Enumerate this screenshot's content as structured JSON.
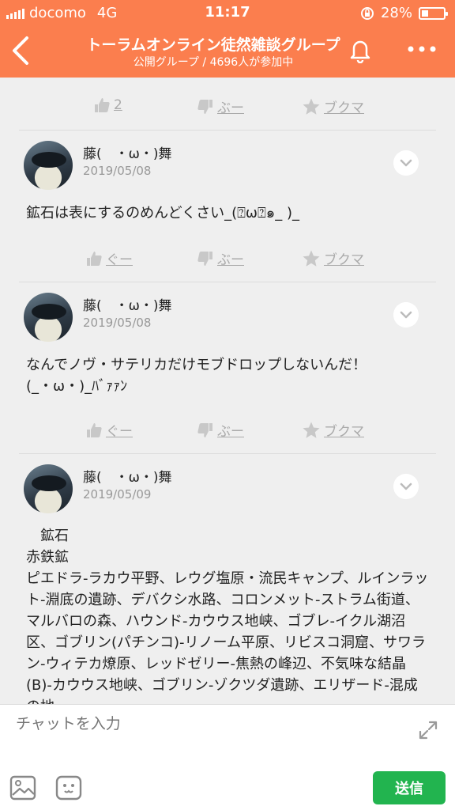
{
  "status_bar": {
    "carrier": "docomo",
    "network": "4G",
    "time": "11:17",
    "battery": "28%"
  },
  "header": {
    "title": "トーラムオンライン徒然雑談グループ",
    "subtitle": "公開グループ / 4696人が参加中"
  },
  "top_reactions": {
    "like": "2",
    "dislike": "ぶー",
    "bookmark": "ブクマ"
  },
  "posts": [
    {
      "author": "藤(　・ω・)舞",
      "date": "2019/05/08",
      "text": "鉱石は表にするのめんどくさい_(⍰ω⍰๑_ )_",
      "reactions": {
        "like": "ぐー",
        "dislike": "ぶー",
        "bookmark": "ブクマ"
      }
    },
    {
      "author": "藤(　・ω・)舞",
      "date": "2019/05/08",
      "text": "なんでノヴ・サテリカだけモブドロップしないんだ！\n(_・ω・)_ﾊﾞｧｧﾝ",
      "reactions": {
        "like": "ぐー",
        "dislike": "ぶー",
        "bookmark": "ブクマ"
      }
    },
    {
      "author": "藤(　・ω・)舞",
      "date": "2019/05/09",
      "text": "　鉱石\n赤鉄鉱\nピエドラ-ラカウ平野、レウグ塩原・流民キャンプ、ルインラット-淵底の遺跡、デバクシ水路、コロンメット-ストラム街道、マルバロの森、ハウンド-カウウス地峡、ゴブレ-イクル湖沼区、ゴブリン(パチンコ)-リノーム平原、リビスコ洞窟、サワラン-ウィテカ燎原、レッドゼリー-焦熱の峰辺、不気味な結晶(B)-カウウス地峡、ゴブリン-ゾクツダ遺跡、エリザード-混成の地"
    }
  ],
  "composer": {
    "placeholder": "チャットを入力",
    "send_label": "送信"
  }
}
